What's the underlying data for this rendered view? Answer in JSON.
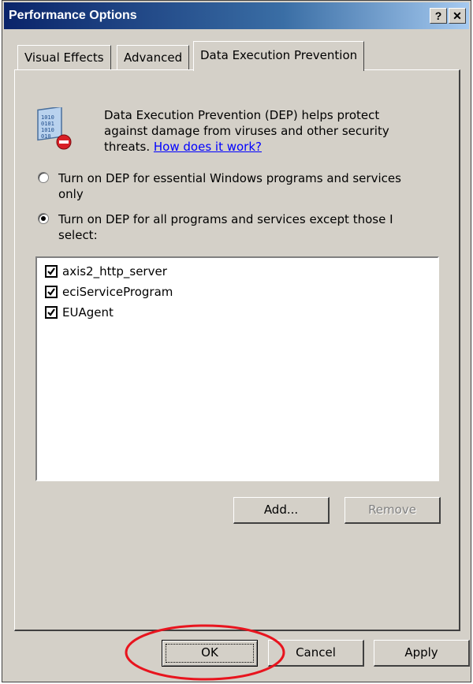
{
  "window": {
    "title": "Performance Options",
    "help_glyph": "?",
    "close_glyph": "✕"
  },
  "tabs": [
    {
      "label": "Visual Effects",
      "active": false
    },
    {
      "label": "Advanced",
      "active": false
    },
    {
      "label": "Data Execution Prevention",
      "active": true
    }
  ],
  "dep": {
    "icon": "dep-shield-icon",
    "description": "Data Execution Prevention (DEP) helps protect against damage from viruses and other security threats.",
    "link": "How does it work?"
  },
  "options": [
    {
      "label": "Turn on DEP for essential Windows programs and services only",
      "selected": false
    },
    {
      "label": "Turn on DEP for all programs and services except those I select:",
      "selected": true
    }
  ],
  "exceptions": [
    {
      "label": "axis2_http_server",
      "checked": true
    },
    {
      "label": "eciServiceProgram",
      "checked": true
    },
    {
      "label": "EUAgent",
      "checked": true
    }
  ],
  "list_buttons": {
    "add": "Add...",
    "remove": "Remove"
  },
  "footer": {
    "ok": "OK",
    "cancel": "Cancel",
    "apply": "Apply"
  },
  "colors": {
    "annotation": "#e8141e",
    "title_start": "#0a246a",
    "title_end": "#a6caf0",
    "face": "#d4d0c8"
  }
}
